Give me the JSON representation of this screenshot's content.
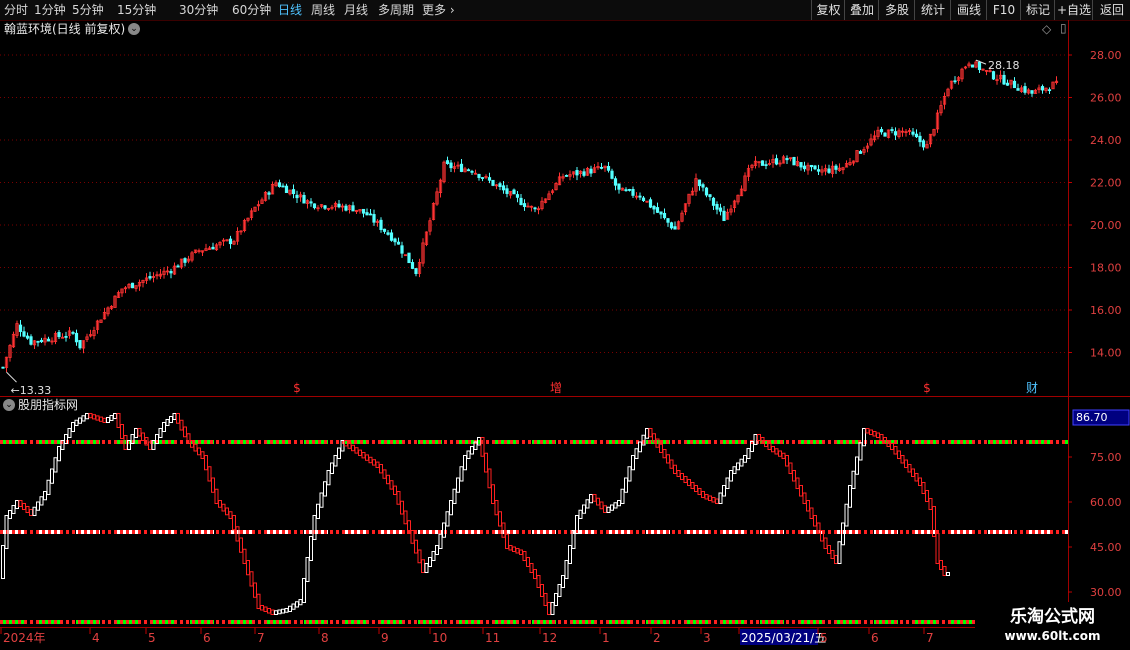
{
  "toolbar": {
    "periods": [
      "分时",
      "1分钟",
      "5分钟",
      "15分钟",
      "30分钟",
      "60分钟",
      "日线",
      "周线",
      "月线",
      "多周期"
    ],
    "more_label": "更多",
    "active": "日线",
    "right_buttons": [
      "复权",
      "叠加",
      "多股",
      "统计",
      "画线",
      "F10",
      "标记",
      "+自选",
      "返回"
    ]
  },
  "main_chart": {
    "title": "翰蓝环境(日线 前复权)",
    "high_label": "28.18",
    "low_label": "13.33",
    "y_ticks": [
      "28.00",
      "26.00",
      "24.00",
      "22.00",
      "20.00",
      "18.00",
      "16.00",
      "14.00"
    ],
    "events": [
      {
        "label": "$",
        "color": "#ff3030",
        "i": 84
      },
      {
        "label": "增",
        "color": "#ff3030",
        "i": 158
      },
      {
        "label": "$",
        "color": "#ff3030",
        "i": 264
      },
      {
        "label": "财",
        "color": "#4fc3ff",
        "i": 294
      }
    ],
    "colors": {
      "up": "#ff3232",
      "down": "#54ffff"
    }
  },
  "indicator": {
    "title": "股朋指标网",
    "current_value": "86.70",
    "y_ticks": [
      "75.00",
      "60.00",
      "45.00",
      "30.00"
    ],
    "colors": {
      "rise": "#ffffff",
      "fall": "#ff2020",
      "upper": "#00ff00",
      "mid": "#ffffff",
      "dot": "#ff2020"
    }
  },
  "time_axis": {
    "labels": [
      "2024年",
      "4",
      "5",
      "6",
      "7",
      "8",
      "9",
      "10",
      "11",
      "12",
      "1",
      "2",
      "3",
      "2025/03/21/五",
      "5",
      "6",
      "7"
    ]
  },
  "watermark": {
    "line1": "乐淘公式网",
    "line2": "www.60lt.com"
  },
  "chart_data": {
    "type": "candlestick",
    "y_range": [
      12.8,
      28.8
    ],
    "indicator_range": [
      22,
      90
    ],
    "indicator_levels": [
      80,
      50,
      20
    ],
    "anchors": [
      [
        0,
        13.3
      ],
      [
        4,
        15.3
      ],
      [
        8,
        14.5
      ],
      [
        20,
        14.9
      ],
      [
        22,
        14.3
      ],
      [
        34,
        17.0
      ],
      [
        48,
        17.9
      ],
      [
        56,
        18.8
      ],
      [
        66,
        19.3
      ],
      [
        72,
        20.8
      ],
      [
        78,
        22.0
      ],
      [
        88,
        21.0
      ],
      [
        100,
        20.8
      ],
      [
        104,
        20.5
      ],
      [
        112,
        19.3
      ],
      [
        118,
        17.8
      ],
      [
        122,
        20.2
      ],
      [
        126,
        22.8
      ],
      [
        134,
        22.6
      ],
      [
        146,
        21.3
      ],
      [
        152,
        20.7
      ],
      [
        160,
        22.3
      ],
      [
        172,
        22.7
      ],
      [
        176,
        21.6
      ],
      [
        182,
        21.4
      ],
      [
        192,
        19.8
      ],
      [
        198,
        22.1
      ],
      [
        206,
        20.3
      ],
      [
        214,
        22.8
      ],
      [
        224,
        23.1
      ],
      [
        232,
        22.5
      ],
      [
        240,
        22.7
      ],
      [
        250,
        24.3
      ],
      [
        258,
        24.4
      ],
      [
        264,
        23.7
      ],
      [
        270,
        26.5
      ],
      [
        276,
        27.7
      ],
      [
        282,
        27.1
      ],
      [
        294,
        26.2
      ],
      [
        300,
        26.6
      ]
    ],
    "oscillator": [
      [
        0,
        35
      ],
      [
        2,
        55
      ],
      [
        5,
        60
      ],
      [
        9,
        56
      ],
      [
        13,
        63
      ],
      [
        17,
        78
      ],
      [
        21,
        86
      ],
      [
        25,
        89
      ],
      [
        30,
        87
      ],
      [
        33,
        89
      ],
      [
        36,
        78
      ],
      [
        39,
        84
      ],
      [
        43,
        78
      ],
      [
        47,
        86
      ],
      [
        50,
        89
      ],
      [
        54,
        80
      ],
      [
        58,
        75
      ],
      [
        62,
        60
      ],
      [
        66,
        55
      ],
      [
        70,
        40
      ],
      [
        74,
        25
      ],
      [
        78,
        23
      ],
      [
        82,
        24
      ],
      [
        86,
        27
      ],
      [
        90,
        55
      ],
      [
        94,
        70
      ],
      [
        98,
        80
      ],
      [
        103,
        76
      ],
      [
        108,
        72
      ],
      [
        113,
        63
      ],
      [
        117,
        50
      ],
      [
        121,
        37
      ],
      [
        125,
        45
      ],
      [
        129,
        60
      ],
      [
        133,
        75
      ],
      [
        137,
        81
      ],
      [
        141,
        60
      ],
      [
        145,
        45
      ],
      [
        149,
        43
      ],
      [
        153,
        35
      ],
      [
        157,
        23
      ],
      [
        161,
        35
      ],
      [
        165,
        55
      ],
      [
        169,
        62
      ],
      [
        173,
        57
      ],
      [
        177,
        60
      ],
      [
        181,
        75
      ],
      [
        185,
        84
      ],
      [
        189,
        77
      ],
      [
        193,
        70
      ],
      [
        197,
        66
      ],
      [
        201,
        62
      ],
      [
        205,
        60
      ],
      [
        209,
        70
      ],
      [
        213,
        75
      ],
      [
        216,
        82
      ],
      [
        220,
        78
      ],
      [
        224,
        75
      ],
      [
        228,
        65
      ],
      [
        232,
        55
      ],
      [
        236,
        45
      ],
      [
        239,
        40
      ],
      [
        243,
        65
      ],
      [
        247,
        84
      ],
      [
        251,
        82
      ],
      [
        255,
        78
      ],
      [
        259,
        72
      ],
      [
        263,
        66
      ],
      [
        266,
        58
      ],
      [
        268,
        40
      ],
      [
        270,
        36
      ]
    ]
  }
}
